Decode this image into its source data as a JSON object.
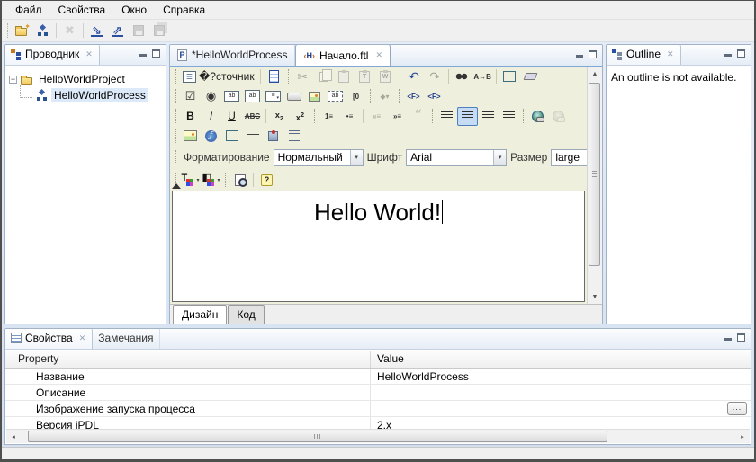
{
  "menubar": {
    "items": [
      "Файл",
      "Свойства",
      "Окно",
      "Справка"
    ]
  },
  "main_toolbar": {
    "items": [
      {
        "name": "new-project-button"
      },
      {
        "name": "new-process-button"
      },
      {
        "sep": true
      },
      {
        "name": "delete-button",
        "disabled": true
      },
      {
        "sep": true
      },
      {
        "name": "import-button"
      },
      {
        "name": "export-button"
      },
      {
        "name": "save-button",
        "disabled": true
      },
      {
        "name": "save-all-button",
        "disabled": true
      }
    ]
  },
  "explorer": {
    "title": "Проводник",
    "project_label": "HelloWorldProject",
    "process_label": "HelloWorldProcess"
  },
  "outline": {
    "title": "Outline",
    "message": "An outline is not available."
  },
  "editor": {
    "tabs": [
      {
        "label": "*HelloWorldProcess",
        "icon": "process-file-icon"
      },
      {
        "label": "Начало.ftl",
        "icon": "ftl-file-icon",
        "active": true
      }
    ],
    "toolbar": {
      "row1": [
        {
          "handle": true
        },
        {
          "name": "source-button",
          "label": "�?сточник"
        },
        {
          "sep": true
        },
        {
          "name": "new-page-button"
        },
        {
          "handle": true
        },
        {
          "name": "cut-button",
          "disabled": true
        },
        {
          "name": "copy-button",
          "disabled": true
        },
        {
          "name": "paste-button",
          "disabled": true
        },
        {
          "name": "paste-text-button",
          "disabled": true
        },
        {
          "name": "paste-word-button",
          "disabled": true
        },
        {
          "handle": true
        },
        {
          "name": "undo-button"
        },
        {
          "name": "redo-button",
          "disabled": true
        },
        {
          "sep": true
        },
        {
          "name": "find-button"
        },
        {
          "name": "replace-button"
        },
        {
          "sep": true
        },
        {
          "name": "select-all-button"
        },
        {
          "name": "remove-format-button"
        }
      ],
      "row2": [
        {
          "handle": true
        },
        {
          "name": "checkbox-button"
        },
        {
          "name": "radio-button"
        },
        {
          "name": "text-field-button"
        },
        {
          "name": "textarea-button"
        },
        {
          "name": "select-field-button"
        },
        {
          "name": "button-field-button"
        },
        {
          "name": "image-button-button"
        },
        {
          "name": "hidden-field-button"
        },
        {
          "name": "attachment-button"
        },
        {
          "handle": true
        },
        {
          "name": "insert-variable-button",
          "disabled": true
        },
        {
          "handle": true
        },
        {
          "name": "ftl-tag-button"
        },
        {
          "name": "ftl-expression-button"
        }
      ],
      "row3": [
        {
          "handle": true
        },
        {
          "name": "bold-button"
        },
        {
          "name": "italic-button"
        },
        {
          "name": "underline-button"
        },
        {
          "name": "strikethrough-button"
        },
        {
          "sep": true
        },
        {
          "name": "subscript-button"
        },
        {
          "name": "superscript-button"
        },
        {
          "handle": true
        },
        {
          "name": "numbered-list-button"
        },
        {
          "name": "bulleted-list-button"
        },
        {
          "sep": true
        },
        {
          "name": "decrease-indent-button",
          "disabled": true
        },
        {
          "name": "increase-indent-button"
        },
        {
          "name": "blockquote-button",
          "disabled": true
        },
        {
          "handle": true
        },
        {
          "name": "align-left-button"
        },
        {
          "name": "align-center-button",
          "active": true
        },
        {
          "name": "align-right-button"
        },
        {
          "name": "justify-button"
        },
        {
          "handle": true
        },
        {
          "name": "insert-link-button"
        },
        {
          "name": "remove-link-button",
          "disabled": true
        }
      ],
      "row4": [
        {
          "handle": true
        },
        {
          "name": "insert-image-button"
        },
        {
          "name": "insert-flash-button"
        },
        {
          "name": "insert-table-button"
        },
        {
          "name": "horizontal-rule-button"
        },
        {
          "name": "special-character-button"
        },
        {
          "name": "page-break-button"
        }
      ],
      "row6": [
        {
          "handle": true
        },
        {
          "name": "text-color-button"
        },
        {
          "name": "background-color-button"
        },
        {
          "handle": true
        },
        {
          "name": "preview-button"
        },
        {
          "sep": true
        },
        {
          "name": "about-button"
        }
      ]
    },
    "format_bar": {
      "format_label": "Форматирование",
      "format_value": "Нормальный",
      "font_label": "Шрифт",
      "font_value": "Arial",
      "size_label": "Размер",
      "size_value": "large"
    },
    "content": {
      "text": "Hello World!"
    },
    "bottom_tabs": [
      {
        "label": "Дизайн",
        "active": true
      },
      {
        "label": "Код"
      }
    ]
  },
  "properties_view": {
    "tabs": [
      {
        "label": "Свойства",
        "active": true
      },
      {
        "label": "Замечания"
      }
    ],
    "columns": [
      "Property",
      "Value"
    ],
    "rows": [
      {
        "property": "Название",
        "value": "HelloWorldProcess"
      },
      {
        "property": "Описание",
        "value": ""
      },
      {
        "property": "Изображение запуска процесса",
        "value": "",
        "button": "..."
      },
      {
        "property": "Версия jPDL",
        "value": "2.x"
      }
    ]
  },
  "colors": {
    "editor_toolbar_bg": "#EFEFDE",
    "active_toggle_bg": "#C6DCF5",
    "workbench_bg": "#D9E4F1",
    "tree_selection_bg": "#DCE9F9"
  }
}
